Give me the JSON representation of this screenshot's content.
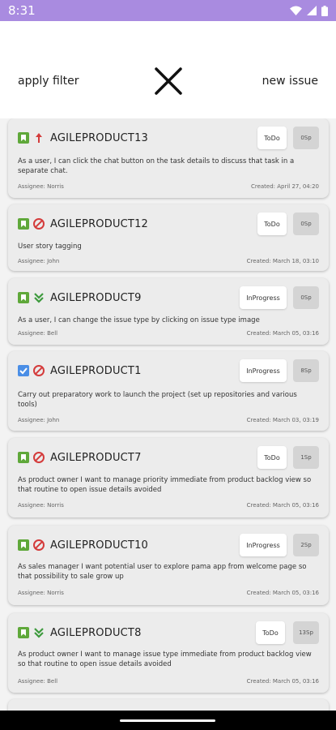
{
  "status_bar": {
    "time": "8:31"
  },
  "toolbar": {
    "apply_filter_label": "apply filter",
    "new_issue_label": "new issue"
  },
  "issues": [
    {
      "key": "AGILEPRODUCT13",
      "type_icon": "story-bookmark-icon",
      "priority_icon": "priority-highest-icon",
      "status": "ToDo",
      "points": "0Sp",
      "description": "As a user, I can click the chat button on the task details to discuss that task in a separate chat.",
      "assignee": "Assignee: Norris",
      "created": "Created: April 27, 04:20"
    },
    {
      "key": "AGILEPRODUCT12",
      "type_icon": "story-bookmark-icon",
      "priority_icon": "priority-blocker-icon",
      "status": "ToDo",
      "points": "0Sp",
      "description": "User story tagging",
      "assignee": "Assignee: John",
      "created": "Created: March 18, 03:10"
    },
    {
      "key": "AGILEPRODUCT9",
      "type_icon": "story-bookmark-icon",
      "priority_icon": "priority-lowest-icon",
      "status": "InProgress",
      "points": "0Sp",
      "description": "As a user, I can change the issue type by clicking on issue type image",
      "assignee": "Assignee: Bell",
      "created": "Created: March 05, 03:16"
    },
    {
      "key": "AGILEPRODUCT1",
      "type_icon": "task-checkbox-icon",
      "priority_icon": "priority-blocker-icon",
      "status": "InProgress",
      "points": "8Sp",
      "description": "Carry out preparatory work to launch the project (set up repositories and various tools)",
      "assignee": "Assignee: John",
      "created": "Created: March 03, 03:19"
    },
    {
      "key": "AGILEPRODUCT7",
      "type_icon": "story-bookmark-icon",
      "priority_icon": "priority-blocker-icon",
      "status": "ToDo",
      "points": "1Sp",
      "description": "As product owner I want to manage priority immediate from product backlog view so that routine to open issue details avoided",
      "assignee": "Assignee: Norris",
      "created": "Created: March 05, 03:16"
    },
    {
      "key": "AGILEPRODUCT10",
      "type_icon": "story-bookmark-icon",
      "priority_icon": "priority-blocker-icon",
      "status": "InProgress",
      "points": "2Sp",
      "description": "As sales manager I want potential user to explore pama app from welcome page so that possibility to sale grow up",
      "assignee": "Assignee: Norris",
      "created": "Created: March 05, 03:16"
    },
    {
      "key": "AGILEPRODUCT8",
      "type_icon": "story-bookmark-icon",
      "priority_icon": "priority-lowest-icon",
      "status": "ToDo",
      "points": "13Sp",
      "description": "As product owner I want to manage issue type immediate from product backlog view so that routine to open issue details avoided",
      "assignee": "Assignee: Bell",
      "created": "Created: March 05, 03:16"
    }
  ],
  "colors": {
    "status_bar": "#a98be0",
    "story_green": "#5fa83a",
    "task_blue": "#4a8ee6",
    "priority_red": "#d43b3b",
    "lowest_green": "#3d9a3d"
  }
}
